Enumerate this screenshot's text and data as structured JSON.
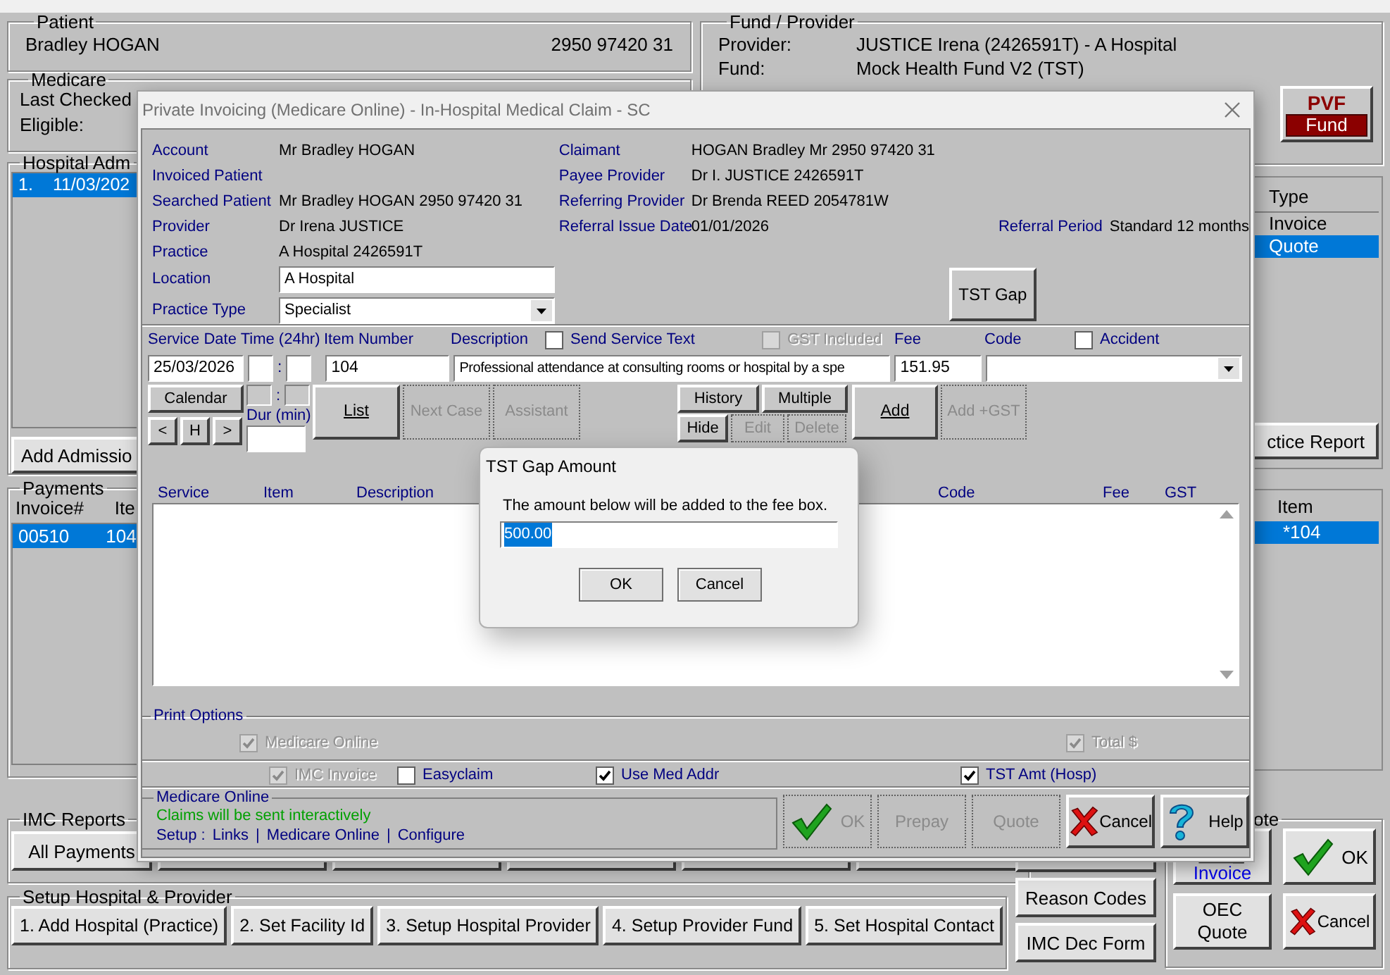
{
  "main_window": {
    "patient": {
      "legend": "Patient",
      "name": "Bradley HOGAN",
      "number": "2950 97420 31"
    },
    "medicare": {
      "legend": "Medicare",
      "labels": [
        "Last Checked",
        "Eligible:"
      ]
    },
    "hospital_admissions": {
      "legend": "Hospital Adm",
      "rows": [
        {
          "number": "1.",
          "date": "11/03/202",
          "selected": true
        }
      ],
      "button": "Add Admissio"
    },
    "payments": {
      "legend": "Payments",
      "columns": [
        "Invoice#",
        "Ite"
      ],
      "rows": [
        {
          "cells": [
            "00510",
            "104"
          ],
          "selected": true
        }
      ]
    },
    "fund_provider": {
      "legend": "Fund / Provider",
      "rows": [
        {
          "label": "Provider:",
          "value": "JUSTICE Irena (2426591T) - A Hospital"
        },
        {
          "label": "Fund:",
          "value": "Mock Health Fund V2  (TST)"
        }
      ],
      "pvf_button": {
        "top": "PVF",
        "bottom": "Fund"
      }
    },
    "type_list": {
      "header": "Type",
      "items": [
        {
          "label": "Invoice",
          "selected": false
        },
        {
          "label": "Quote",
          "selected": true
        }
      ],
      "button": "ctice Report"
    },
    "item_list": {
      "header": "Item",
      "rows": [
        {
          "label": "*104",
          "selected": true
        }
      ]
    },
    "imc_reports": {
      "legend": "IMC Reports",
      "buttons": [
        "All Payments"
      ]
    },
    "setup": {
      "legend": "Setup Hospital & Provider",
      "buttons": [
        "1. Add Hospital (Practice)",
        "2. Set Facility Id",
        "3. Setup Hospital Provider",
        "4. Setup Provider Fund",
        "5. Set Hospital Contact"
      ]
    },
    "side_buttons": [
      "Reason Codes",
      "IMC Dec Form"
    ],
    "quote": {
      "legend": "ote",
      "buttons": [
        {
          "kind": "invoice",
          "label": "Invoice"
        },
        {
          "kind": "ok",
          "label": "OK"
        },
        {
          "kind": "text",
          "label": "OEC Quote"
        },
        {
          "kind": "cancel",
          "label": "Cancel"
        }
      ]
    }
  },
  "invoice_dialog": {
    "title": "Private Invoicing (Medicare Online) - In-Hospital Medical Claim - SC",
    "left_fields": [
      {
        "label": "Account",
        "value": "Mr Bradley HOGAN"
      },
      {
        "label": "Invoiced Patient"
      },
      {
        "label": "Searched Patient",
        "value": "Mr Bradley HOGAN 2950 97420 31"
      },
      {
        "label": "Provider",
        "value": "Dr Irena JUSTICE"
      },
      {
        "label": "Practice",
        "value": "A Hospital 2426591T"
      }
    ],
    "location": {
      "label": "Location",
      "value": "A Hospital"
    },
    "practice_type": {
      "label": "Practice Type",
      "value": "Specialist"
    },
    "right_fields": [
      {
        "label": "Claimant",
        "value": "HOGAN Bradley Mr 2950 97420 31"
      },
      {
        "label": "Payee Provider",
        "value": "Dr I. JUSTICE 2426591T"
      },
      {
        "label": "Referring Provider",
        "value": "Dr Brenda REED 2054781W"
      },
      {
        "label": "Referral Issue Date",
        "value": "01/01/2026"
      }
    ],
    "referral_period": {
      "label": "Referral Period",
      "value": "Standard 12 months"
    },
    "tst_gap_button": "TST Gap",
    "service": {
      "date_time_label": "Service Date Time (24hr)",
      "item_label": "Item Number",
      "description_label": "Description",
      "fee_label": "Fee",
      "code_label": "Code",
      "duration_label": "Dur (min)",
      "options": [
        {
          "label": "Send Service Text",
          "checked": false,
          "disabled": false
        },
        {
          "label": "GST Included",
          "checked": false,
          "disabled": true
        },
        {
          "label": "Accident",
          "checked": false,
          "disabled": false
        }
      ],
      "date": "25/03/2026",
      "time_separators": [
        ":",
        ":"
      ],
      "item": "104",
      "description": "Professional attendance at consulting rooms or  hospital by a spe",
      "fee": "151.95"
    },
    "buttons": {
      "calendar": {
        "label": "Calendar",
        "disabled": false
      },
      "nav": [
        "<",
        "H",
        ">"
      ],
      "list": {
        "label": "List",
        "disabled": false
      },
      "next_case": {
        "label": "Next Case",
        "disabled": true
      },
      "assistant": {
        "label": "Assistant",
        "disabled": true
      },
      "history": {
        "label": "History",
        "disabled": false
      },
      "multiple": {
        "label": "Multiple",
        "disabled": false
      },
      "hide": {
        "label": "Hide",
        "disabled": false
      },
      "edit": {
        "label": "Edit",
        "disabled": true
      },
      "delete": {
        "label": "Delete",
        "disabled": true
      },
      "add": {
        "label": "Add",
        "disabled": false
      },
      "add_gst": {
        "label": "Add +GST",
        "disabled": true
      }
    },
    "table": {
      "columns": [
        "Service",
        "Item",
        "Description",
        "Code",
        "Fee",
        "GST"
      ]
    },
    "print_options": {
      "legend": "Print Options",
      "top_options": [
        {
          "label": "Medicare Online",
          "checked": true,
          "disabled": true
        },
        {
          "label": "Total $",
          "checked": true,
          "disabled": true
        }
      ],
      "row_options": [
        {
          "label": "IMC Invoice",
          "checked": true,
          "disabled": true
        },
        {
          "label": "Easyclaim",
          "checked": false,
          "disabled": false
        },
        {
          "label": "Use Med Addr",
          "checked": true,
          "disabled": false
        },
        {
          "label": "TST Amt (Hosp)",
          "checked": true,
          "disabled": false
        }
      ]
    },
    "medicare_online": {
      "legend": "Medicare Online",
      "status": "Claims will be sent interactively",
      "setup_label": "Setup :",
      "links": [
        "Links",
        "Medicare Online",
        "Configure"
      ],
      "separators": [
        "|",
        "|"
      ]
    },
    "footer_buttons": [
      {
        "kind": "ok",
        "label": "OK",
        "disabled": true
      },
      {
        "kind": "text",
        "label": "Prepay",
        "disabled": true
      },
      {
        "kind": "text",
        "label": "Quote",
        "disabled": true
      },
      {
        "kind": "cancel",
        "label": "Cancel",
        "disabled": false
      },
      {
        "kind": "help",
        "label": "Help",
        "disabled": false
      }
    ]
  },
  "gap_dialog": {
    "title": "TST Gap Amount",
    "message": "The amount below will be added to the fee box.",
    "amount": {
      "value": "500.00",
      "highlighted": true
    },
    "buttons": [
      "OK",
      "Cancel"
    ]
  }
}
